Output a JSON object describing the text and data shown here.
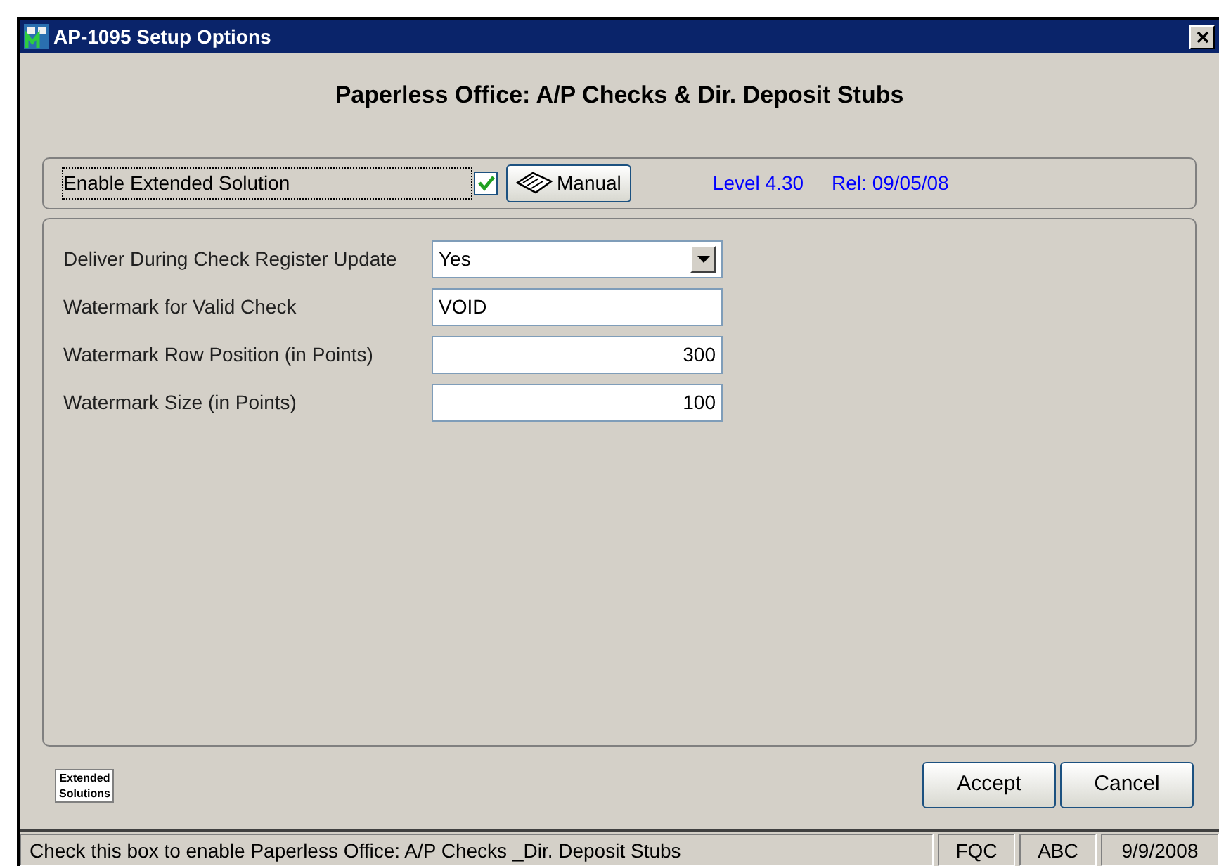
{
  "window": {
    "title": "AP-1095 Setup Options"
  },
  "heading": "Paperless Office: A/P Checks & Dir. Deposit Stubs",
  "extended": {
    "label": "Enable Extended Solution",
    "checked": true,
    "manual_button": "Manual",
    "level": "Level 4.30",
    "release": "Rel: 09/05/08"
  },
  "fields": [
    {
      "kind": "dropdown",
      "label": "Deliver During Check Register Update",
      "value": "Yes"
    },
    {
      "kind": "text",
      "label": "Watermark for Valid Check",
      "value": "VOID"
    },
    {
      "kind": "number",
      "label": "Watermark Row Position (in Points)",
      "value": "300"
    },
    {
      "kind": "number",
      "label": "Watermark Size (in Points)",
      "value": "100"
    }
  ],
  "logo": {
    "line_1": "Extended",
    "line_2": "Solutions"
  },
  "buttons": [
    "Accept",
    "Cancel"
  ],
  "status_bar": {
    "message": "Check this box to enable Paperless Office: A/P Checks _Dir. Deposit Stubs",
    "panels": [
      "FQC",
      "ABC",
      "9/9/2008"
    ]
  }
}
